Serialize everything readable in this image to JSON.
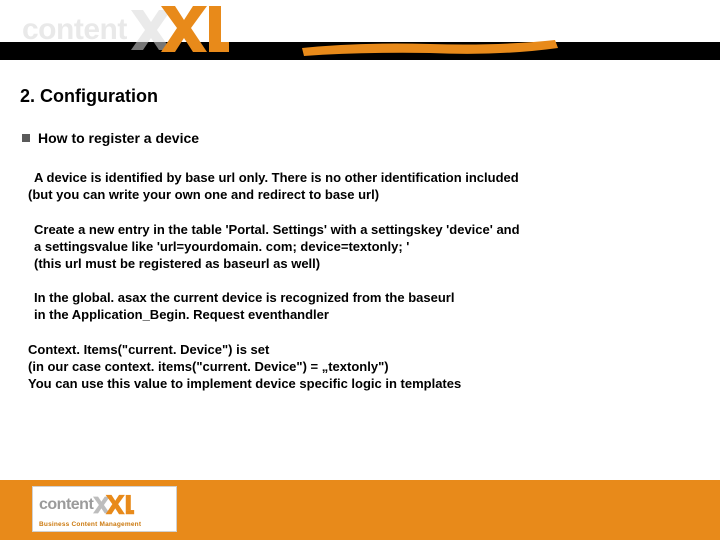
{
  "brand": {
    "name_gray": "content",
    "name_accent": "XXL",
    "tagline": "Business Content Management",
    "accent_color": "#e88a1a",
    "gray_color": "#9b9b9b"
  },
  "slide": {
    "title": "2. Configuration",
    "subheading": "How to register a device",
    "paragraphs": [
      {
        "line1": "A device is identified by base url only. There is no other identification included",
        "line2_prefix": "(",
        "line2_rest": "but you can write your own one and redirect to base url)"
      },
      {
        "text": "Create a new entry in the table 'Portal. Settings' with a settingskey 'device' and\na settingsvalue like 'url=yourdomain. com; device=textonly; '\n(this url must be registered as baseurl as well)"
      },
      {
        "text": "In the global. asax the current device is recognized from the baseurl\nin the Application_Begin. Request eventhandler"
      },
      {
        "line1": "Context. Items(\"current. Device\")  is set",
        "line2": "(in our case context. items(\"current. Device\") = „textonly\")",
        "line3": "You can use this value to implement device specific logic in templates"
      }
    ]
  }
}
